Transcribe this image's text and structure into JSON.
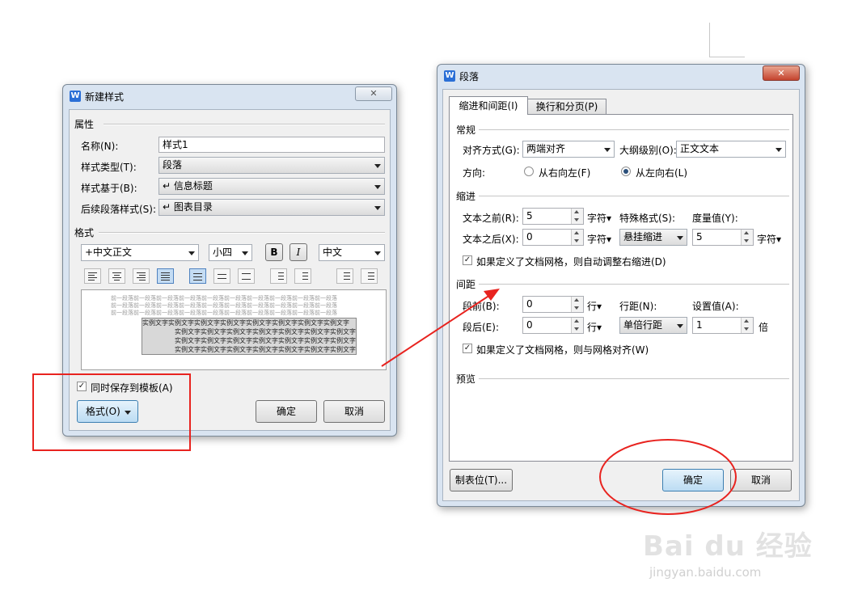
{
  "new_style_dialog": {
    "title": "新建样式",
    "properties_header": "属性",
    "name_label": "名称(N):",
    "name_value": "样式1",
    "type_label": "样式类型(T):",
    "type_value": "段落",
    "based_on_label": "样式基于(B):",
    "based_on_value": "↵ 信息标题",
    "following_label": "后续段落样式(S):",
    "following_value": "↵ 图表目录",
    "format_header": "格式",
    "font_value": "+中文正文",
    "size_value": "小四",
    "bold_label": "B",
    "italic_label": "I",
    "lang_value": "中文",
    "preview_prev_line": "前一段落前一段落前一段落前一段落前一段落前一段落前一段落前一段落前一段落前一段落",
    "preview_sample_line": "实例文字实例文字实例文字实例文字实例文字实例文字实例文字实例文字",
    "save_to_template_label": "同时保存到模板(A)",
    "save_to_template_checked": true,
    "format_button": "格式(O)",
    "ok_button": "确定",
    "cancel_button": "取消"
  },
  "paragraph_dialog": {
    "title": "段落",
    "tabs": [
      {
        "label": "缩进和间距(I)",
        "active": true
      },
      {
        "label": "换行和分页(P)",
        "active": false
      }
    ],
    "general_header": "常规",
    "alignment_label": "对齐方式(G):",
    "alignment_value": "两端对齐",
    "outline_label": "大纲级别(O):",
    "outline_value": "正文文本",
    "direction_label": "方向:",
    "rtl_label": "从右向左(F)",
    "ltr_label": "从左向右(L)",
    "direction_selected": "ltr",
    "indent_header": "缩进",
    "before_text_label": "文本之前(R):",
    "before_text_value": "5",
    "after_text_label": "文本之后(X):",
    "after_text_value": "0",
    "char_unit": "字符▾",
    "special_label": "特殊格式(S):",
    "special_value": "悬挂缩进",
    "measure_label": "度量值(Y):",
    "measure_value": "5",
    "auto_adjust_label": "如果定义了文档网格，则自动调整右缩进(D)",
    "auto_adjust_checked": true,
    "spacing_header": "间距",
    "before_para_label": "段前(B):",
    "before_para_value": "0",
    "after_para_label": "段后(E):",
    "after_para_value": "0",
    "line_unit": "行▾",
    "line_spacing_label": "行距(N):",
    "line_spacing_value": "单倍行距",
    "set_value_label": "设置值(A):",
    "set_value": "1",
    "set_unit": "倍",
    "grid_align_label": "如果定义了文档网格，则与网格对齐(W)",
    "grid_align_checked": true,
    "preview_header": "预览",
    "tab_stops_button": "制表位(T)...",
    "ok_button": "确定",
    "cancel_button": "取消"
  },
  "watermark": {
    "brand": "Bai du 经验",
    "url": "jingyan.baidu.com"
  },
  "annotation_color": "#e8231f"
}
